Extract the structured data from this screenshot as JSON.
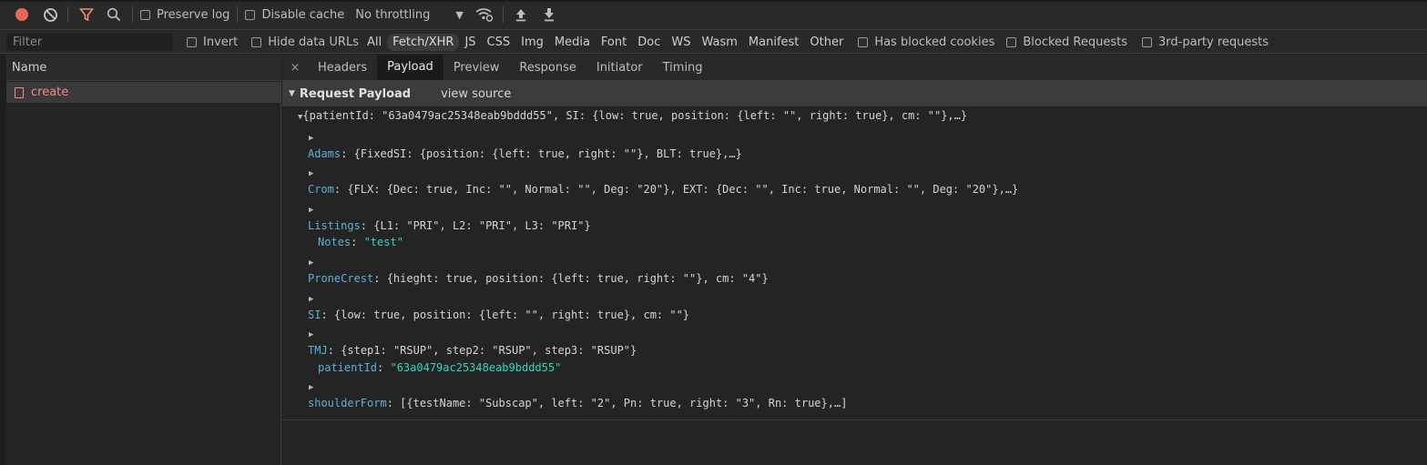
{
  "toolbar": {
    "preserve_log": "Preserve log",
    "disable_cache": "Disable cache",
    "throttling": "No throttling"
  },
  "filterbar": {
    "filter_placeholder": "Filter",
    "invert": "Invert",
    "hide_data_urls": "Hide data URLs",
    "types": [
      "All",
      "Fetch/XHR",
      "JS",
      "CSS",
      "Img",
      "Media",
      "Font",
      "Doc",
      "WS",
      "Wasm",
      "Manifest",
      "Other"
    ],
    "active_type": "Fetch/XHR",
    "has_blocked_cookies": "Has blocked cookies",
    "blocked_requests": "Blocked Requests",
    "third_party": "3rd-party requests"
  },
  "requests": {
    "header": "Name",
    "items": [
      {
        "name": "create"
      }
    ]
  },
  "detail": {
    "close": "×",
    "tabs": [
      "Headers",
      "Payload",
      "Preview",
      "Response",
      "Initiator",
      "Timing"
    ],
    "active_tab": "Payload",
    "section_title": "Request Payload",
    "view_source": "view source",
    "summary": "{patientId: \"63a0479ac25348eab9bddd55\", SI: {low: true, position: {left: \"\", right: true}, cm: \"\"},…}",
    "entries": [
      {
        "key": "Adams",
        "value": "{FixedSI: {position: {left: true, right: \"\"}, BLT: true},…}"
      },
      {
        "key": "Crom",
        "value": "{FLX: {Dec: true, Inc: \"\", Normal: \"\", Deg: \"20\"}, EXT: {Dec: \"\", Inc: true, Normal: \"\", Deg: \"20\"},…}"
      },
      {
        "key": "Listings",
        "value": "{L1: \"PRI\", L2: \"PRI\", L3: \"PRI\"}"
      },
      {
        "key": "Notes",
        "value": "\"test\""
      },
      {
        "key": "ProneCrest",
        "value": "{hieght: true, position: {left: true, right: \"\"}, cm: \"4\"}"
      },
      {
        "key": "SI",
        "value": "{low: true, position: {left: \"\", right: true}, cm: \"\"}"
      },
      {
        "key": "TMJ",
        "value": "{step1: \"RSUP\", step2: \"RSUP\", step3: \"RSUP\"}"
      },
      {
        "key": "patientId",
        "value": "\"63a0479ac25348eab9bddd55\""
      },
      {
        "key": "shoulderForm",
        "value": "[{testName: \"Subscap\", left: \"2\", Pn: true, right: \"3\", Rn: true},…]"
      }
    ]
  }
}
